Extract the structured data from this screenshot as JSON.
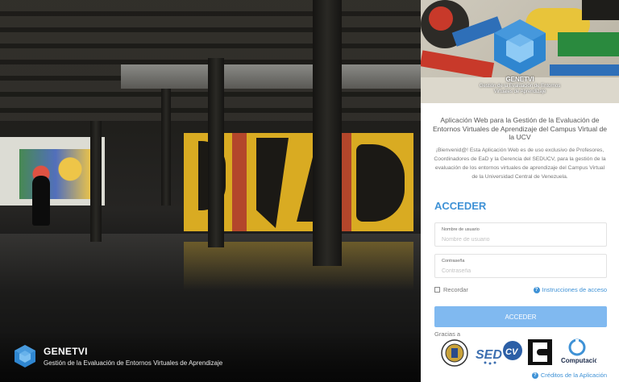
{
  "left": {
    "brand_name": "GENETVI",
    "brand_tagline": "Gestión de la Evaluación de Entornos Virtuales de Aprendizaje"
  },
  "banner": {
    "title": "GENETVI",
    "subtitle": "Gestión de la Evaluación de Entornos Virtuales de Aprendizaje"
  },
  "login": {
    "app_title": "Aplicación Web para la Gestión de la Evaluación de Entornos Virtuales de Aprendizaje del Campus Virtual de la UCV",
    "intro": "¡Bienvenid@! Esta Aplicación Web es de uso exclusivo de Profesores, Coordinadores de EaD y la Gerencia del SEDUCV, para la gestión de la evaluación de los entornos virtuales de aprendizaje del Campus Virtual de la Universidad Central de Venezuela.",
    "heading": "ACCEDER",
    "username_label": "Nombre de usuario",
    "username_placeholder": "Nombre de usuario",
    "username_value": "",
    "password_label": "Contraseña",
    "password_placeholder": "Contraseña",
    "password_value": "",
    "remember_label": "Recordar",
    "instructions_link": "Instrucciones de acceso",
    "submit_label": "ACCEDER",
    "thanks_label": "Gracias a",
    "credits_link": "Créditos de la Aplicación"
  },
  "colors": {
    "accent": "#3f92d6",
    "button": "#80b9f0",
    "mural_yellow": "#d9ab22"
  },
  "icons": [
    "cube-logo-icon",
    "question-circle-icon",
    "checkbox-icon",
    "ucv-seal-logo",
    "sedcv-logo",
    "escuela-computacion-logo",
    "puzzle-logo"
  ]
}
